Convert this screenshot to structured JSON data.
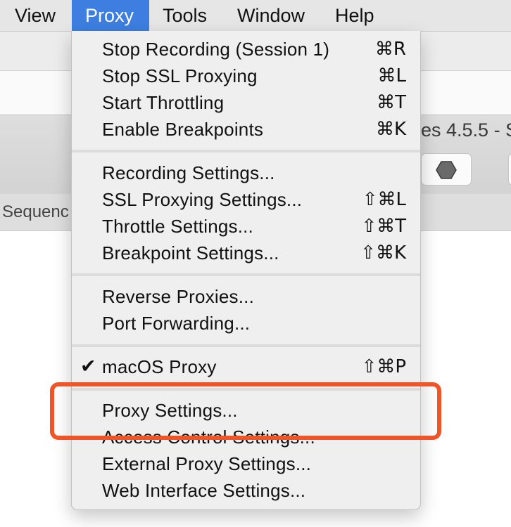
{
  "menubar": {
    "items": [
      {
        "label": "View"
      },
      {
        "label": "Proxy"
      },
      {
        "label": "Tools"
      },
      {
        "label": "Window"
      },
      {
        "label": "Help"
      }
    ]
  },
  "window": {
    "title_fragment": "es 4.5.5 - S",
    "tab_fragment": "Sequenc"
  },
  "proxy_menu": {
    "items": [
      {
        "label": "Stop Recording (Session 1)",
        "shortcut": "⌘R"
      },
      {
        "label": "Stop SSL Proxying",
        "shortcut": "⌘L"
      },
      {
        "label": "Start Throttling",
        "shortcut": "⌘T"
      },
      {
        "label": "Enable Breakpoints",
        "shortcut": "⌘K"
      },
      {
        "label": "Recording Settings...",
        "shortcut": ""
      },
      {
        "label": "SSL Proxying Settings...",
        "shortcut": "⇧⌘L"
      },
      {
        "label": "Throttle Settings...",
        "shortcut": "⇧⌘T"
      },
      {
        "label": "Breakpoint Settings...",
        "shortcut": "⇧⌘K"
      },
      {
        "label": "Reverse Proxies...",
        "shortcut": ""
      },
      {
        "label": "Port Forwarding...",
        "shortcut": ""
      },
      {
        "label": "macOS Proxy",
        "shortcut": "⇧⌘P",
        "checked": true,
        "check": "✔"
      },
      {
        "label": "Proxy Settings...",
        "shortcut": ""
      },
      {
        "label": "Access Control Settings...",
        "shortcut": ""
      },
      {
        "label": "External Proxy Settings...",
        "shortcut": ""
      },
      {
        "label": "Web Interface Settings...",
        "shortcut": ""
      }
    ]
  },
  "colors": {
    "menubar_active": "#3d7ee0",
    "highlight": "#ef5526",
    "menu_background": "#efefef"
  }
}
